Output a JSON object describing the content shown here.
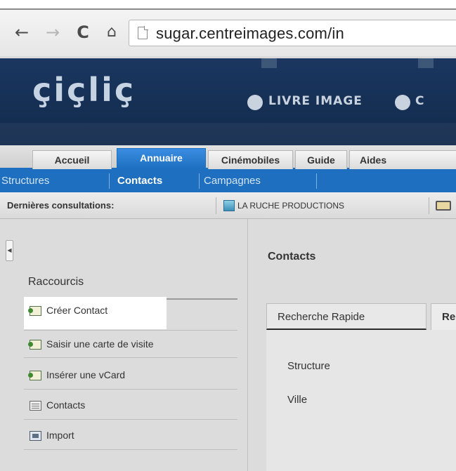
{
  "browser": {
    "nav": {
      "back": "←",
      "forward": "→",
      "reload": "C",
      "home": "⌂"
    },
    "url": "sugar.centreimages.com/in"
  },
  "banner": {
    "logo": "çiçliç",
    "sections": [
      "LIVRE IMAGE",
      "C"
    ]
  },
  "main_tabs": [
    {
      "label": "Accueil",
      "active": false
    },
    {
      "label": "Annuaire",
      "active": true
    },
    {
      "label": "Cinémobiles",
      "active": false
    },
    {
      "label": "Guide",
      "active": false
    },
    {
      "label": "Aides",
      "active": false
    }
  ],
  "sub_tabs": [
    {
      "label": "Structures",
      "active": false
    },
    {
      "label": "Contacts",
      "active": true
    },
    {
      "label": "Campagnes",
      "active": false
    }
  ],
  "recent": {
    "label": "Dernières consultations:",
    "items": [
      "LA RUCHE PRODUCTIONS"
    ]
  },
  "sidebar": {
    "title": "Raccourcis",
    "items": [
      {
        "label": "Créer Contact",
        "icon": "contact-card-icon"
      },
      {
        "label": "Saisir une carte de visite",
        "icon": "contact-card-icon"
      },
      {
        "label": "Insérer une vCard",
        "icon": "contact-card-icon"
      },
      {
        "label": "Contacts",
        "icon": "list-icon"
      },
      {
        "label": "Import",
        "icon": "import-icon"
      }
    ]
  },
  "main": {
    "title": "Contacts",
    "tabs": [
      "Recherche Rapide",
      "Re"
    ],
    "fields": [
      "Structure",
      "Ville"
    ]
  },
  "colors": {
    "accent": "#1e6fc0",
    "banner": "#163055",
    "panel": "#dcdcdc"
  }
}
